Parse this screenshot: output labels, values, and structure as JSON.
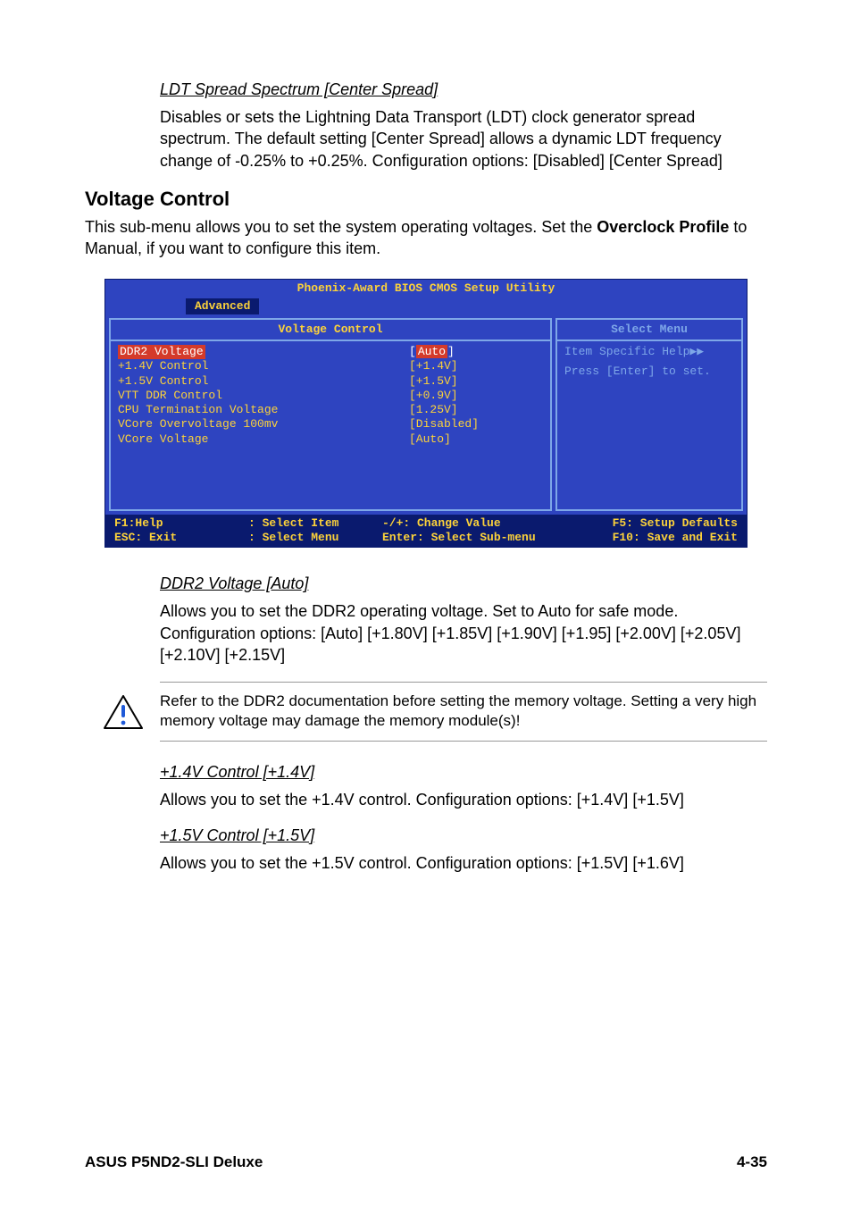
{
  "ldt": {
    "heading": "LDT Spread Spectrum [Center Spread]",
    "body": "Disables or sets the Lightning Data Transport (LDT) clock generator spread spectrum. The default setting [Center Spread] allows a dynamic LDT frequency change of -0.25% to +0.25%. Configuration options: [Disabled] [Center Spread]"
  },
  "voltage_control": {
    "heading": "Voltage Control",
    "intro_pre": "This sub-menu allows you to set the system operating voltages. Set the ",
    "intro_bold": "Overclock Profile",
    "intro_post": " to Manual, if you want to configure this item."
  },
  "bios": {
    "title": "Phoenix-Award BIOS CMOS Setup Utility",
    "tab": "Advanced",
    "left_header": "Voltage Control",
    "right_header": "Select Menu",
    "rows": [
      {
        "label": "DDR2 Voltage",
        "value": "Auto",
        "selected": true
      },
      {
        "label": "+1.4V Control",
        "value": "[+1.4V]",
        "selected": false
      },
      {
        "label": "+1.5V Control",
        "value": "[+1.5V]",
        "selected": false
      },
      {
        "label": "VTT DDR Control",
        "value": "[+0.9V]",
        "selected": false
      },
      {
        "label": "CPU Termination Voltage",
        "value": "[1.25V]",
        "selected": false
      },
      {
        "label": "VCore Overvoltage 100mv",
        "value": "[Disabled]",
        "selected": false
      },
      {
        "label": "VCore Voltage",
        "value": "[Auto]",
        "selected": false
      }
    ],
    "help_line1": "Item Specific Help▶▶",
    "help_line2": "Press [Enter] to set.",
    "footer": {
      "r1c1": "F1:Help",
      "r1c2": ": Select Item",
      "r1c3": "-/+: Change Value",
      "r1c4": "F5: Setup Defaults",
      "r2c1": "ESC: Exit",
      "r2c2": ": Select Menu",
      "r2c3": "Enter: Select Sub-menu",
      "r2c4": "F10: Save and Exit"
    }
  },
  "ddr2": {
    "heading": "DDR2 Voltage [Auto]",
    "body": "Allows you to set the DDR2 operating voltage. Set to Auto for safe mode. Configuration options: [Auto] [+1.80V] [+1.85V] [+1.90V] [+1.95] [+2.00V] [+2.05V] [+2.10V] [+2.15V]"
  },
  "warning": {
    "text": "Refer to the DDR2 documentation before setting the memory voltage. Setting a very high memory voltage may damage the memory module(s)!"
  },
  "ctrl14": {
    "heading": "+1.4V Control [+1.4V]",
    "body": "Allows you to set the +1.4V control. Configuration options: [+1.4V] [+1.5V]"
  },
  "ctrl15": {
    "heading": "+1.5V Control [+1.5V]",
    "body": "Allows you to set the +1.5V control. Configuration options: [+1.5V] [+1.6V]"
  },
  "footer": {
    "left": "ASUS P5ND2-SLI Deluxe",
    "right": "4-35"
  }
}
